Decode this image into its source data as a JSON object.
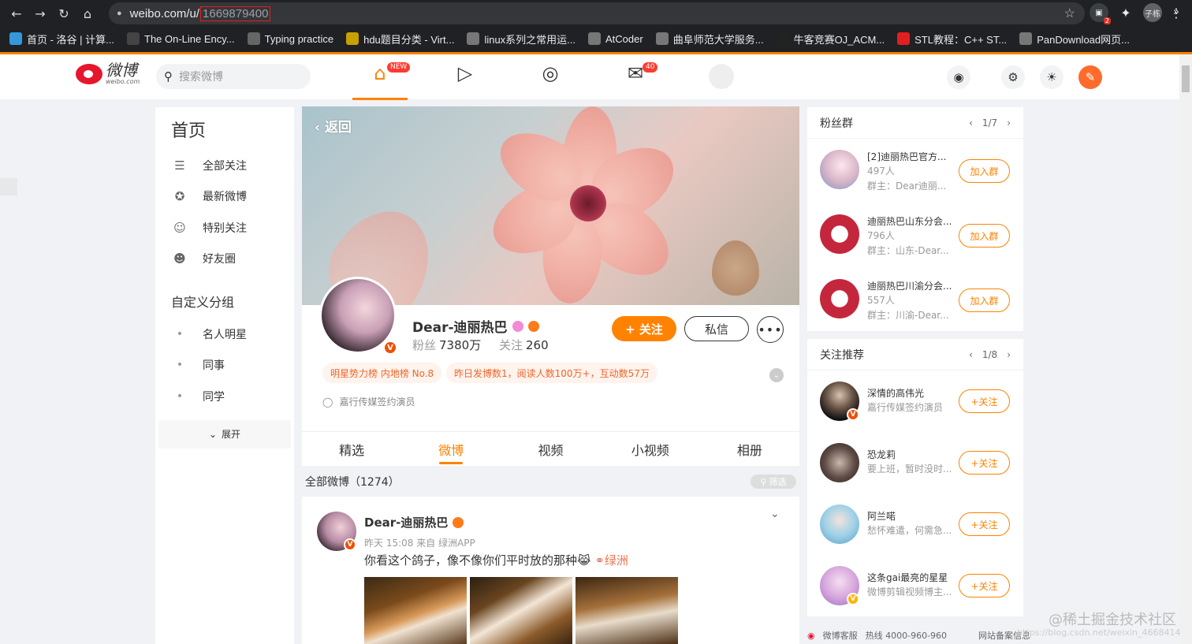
{
  "browser": {
    "url_host": "weibo.com/u/",
    "url_path": "1669879400",
    "extensions": [
      {
        "name": "ext-badge-2",
        "badge": "2"
      },
      {
        "name": "puzzle"
      },
      {
        "name": "profile",
        "label": "子栋"
      }
    ],
    "bookmarks": [
      {
        "icon": "luogu",
        "label": "首页 - 洛谷 | 计算...",
        "color": "#3498db"
      },
      {
        "icon": "oeis",
        "label": "The On-Line Ency...",
        "color": "#444"
      },
      {
        "icon": "typing",
        "label": "Typing practice",
        "color": "#666"
      },
      {
        "icon": "hdu",
        "label": "hdu题目分类 - Virt...",
        "color": "#c8a000"
      },
      {
        "icon": "globe",
        "label": "linux系列之常用运...",
        "color": "#777"
      },
      {
        "icon": "globe",
        "label": "AtCoder",
        "color": "#777"
      },
      {
        "icon": "home",
        "label": "曲阜师范大学服务...",
        "color": "#777"
      },
      {
        "icon": "nowcoder",
        "label": "牛客竞赛OJ_ACM...",
        "color": "#222"
      },
      {
        "icon": "c",
        "label": "STL教程：C++ ST...",
        "color": "#e02020"
      },
      {
        "icon": "globe",
        "label": "PanDownload网页...",
        "color": "#777"
      }
    ],
    "more": "»"
  },
  "weibo_header": {
    "logo_text": "微博",
    "logo_sub": "weibo.com",
    "search_placeholder": "搜索微博",
    "home_badge": "NEW",
    "msg_badge": "40"
  },
  "left_nav": {
    "title": "首页",
    "items": [
      {
        "icon": "list-icon",
        "label": "全部关注"
      },
      {
        "icon": "star-icon",
        "label": "最新微博"
      },
      {
        "icon": "user-icon",
        "label": "特别关注"
      },
      {
        "icon": "friends-icon",
        "label": "好友圈"
      }
    ],
    "group_title": "自定义分组",
    "groups": [
      "名人明星",
      "同事",
      "同学"
    ],
    "expand_label": "展开"
  },
  "profile": {
    "back_label": "返回",
    "name": "Dear-迪丽热巴",
    "fans_label": "粉丝",
    "fans_value": "7380万",
    "follow_label": "关注",
    "follow_value": "260",
    "follow_btn": "+ 关注",
    "msg_btn": "私信",
    "tags": [
      "明星势力榜 内地榜 No.8",
      "昨日发博数1，阅读人数100万+，互动数57万"
    ],
    "desc": "嘉行传媒签约演员"
  },
  "tabs": [
    "精选",
    "微博",
    "视频",
    "小视频",
    "相册"
  ],
  "active_tab": "微博",
  "feed": {
    "all_label": "全部微博（1274）",
    "filter_label": "筛选",
    "post": {
      "name": "Dear-迪丽热巴",
      "meta": "昨天 15:08 来自 绿洲APP",
      "text": "你看这个鸽子，像不像你们平时放的那种",
      "link": "绿洲"
    }
  },
  "fan_groups": {
    "title": "粉丝群",
    "pager": "1/7",
    "items": [
      {
        "name": "[2]迪丽热巴官方...",
        "count": "497人",
        "owner": "群主：Dear迪丽...",
        "btn": "加入群"
      },
      {
        "name": "迪丽热巴山东分会...",
        "count": "796人",
        "owner": "群主：山东-Dear...",
        "btn": "加入群"
      },
      {
        "name": "迪丽热巴川渝分会...",
        "count": "557人",
        "owner": "群主：川渝-Dear...",
        "btn": "加入群"
      }
    ]
  },
  "recommend": {
    "title": "关注推荐",
    "pager": "1/8",
    "items": [
      {
        "name": "深情的高伟光",
        "desc": "嘉行传媒签约演员",
        "btn": "+关注"
      },
      {
        "name": "恐龙莉",
        "desc": "要上班，暂时没时...",
        "btn": "+关注"
      },
      {
        "name": "阿兰喏",
        "desc": "愁怀难遣，何需急...",
        "btn": "+关注"
      },
      {
        "name": "这条gai最亮的星星",
        "desc": "微博剪辑视频博主...",
        "btn": "+关注"
      }
    ]
  },
  "footer": {
    "service": "微博客服",
    "hotline": "热线 4000-960-960",
    "record": "网站备案信息"
  },
  "watermark": {
    "text": "@稀土掘金技术社区",
    "small": "https://blog.csdn.net/weixin_4668414"
  }
}
